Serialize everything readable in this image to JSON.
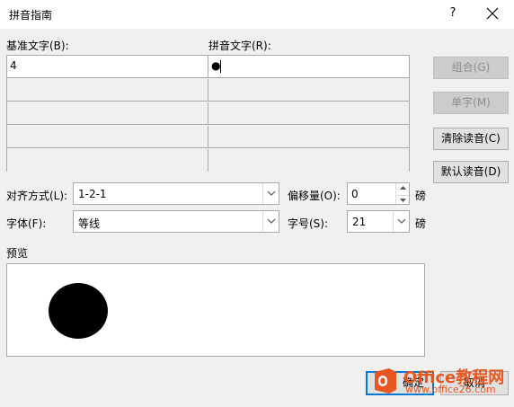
{
  "window": {
    "title": "拼音指南",
    "help_label": "?",
    "close_icon": "close-icon"
  },
  "base_text": {
    "label": "基准文字(B):",
    "rows": [
      "4",
      "",
      "",
      "",
      ""
    ]
  },
  "ruby_text": {
    "label": "拼音文字(R):",
    "rows": [
      "●",
      "",
      "",
      "",
      ""
    ]
  },
  "side_buttons": {
    "group": "组合(G)",
    "mono": "单字(M)",
    "clear": "清除读音(C)",
    "default": "默认读音(D)"
  },
  "alignment": {
    "label": "对齐方式(L):",
    "value": "1-2-1"
  },
  "offset": {
    "label": "偏移量(O):",
    "value": "0",
    "unit": "磅"
  },
  "font": {
    "label": "字体(F):",
    "value": "等线"
  },
  "size": {
    "label": "字号(S):",
    "value": "21",
    "unit": "磅"
  },
  "preview": {
    "label": "预览"
  },
  "footer": {
    "ok": "确定",
    "cancel": "取消"
  },
  "watermark": {
    "brand": "Office教程网",
    "url": "www.office26.com",
    "color": "#e8571f"
  }
}
